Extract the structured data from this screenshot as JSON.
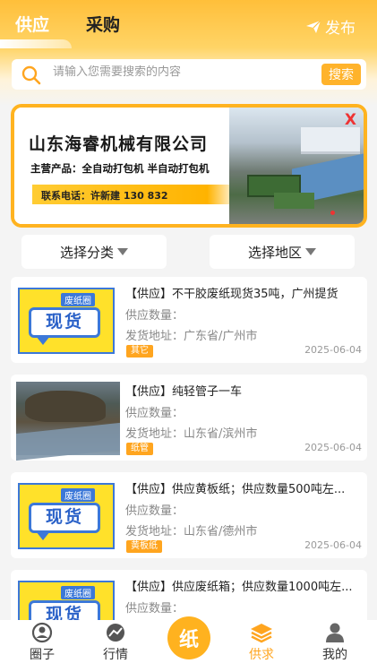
{
  "header": {
    "tab_supply": "供应",
    "tab_buy": "采购",
    "publish_label": "发布",
    "publish_icon": "paper-plane-icon"
  },
  "search": {
    "placeholder": "请输入您需要搜索的内容",
    "button_label": "搜索"
  },
  "banner": {
    "company": "山东海睿机械有限公司",
    "products": "主营产品：全自动打包机 半自动打包机",
    "contact": "联系电话：许新建 130        832",
    "close_label": "X"
  },
  "filters": {
    "category_label": "选择分类",
    "region_label": "选择地区"
  },
  "listings": [
    {
      "title": "【供应】不干胶废纸现货35吨，广州提货",
      "qty_label": "供应数量：",
      "address": "发货地址：广东省/广州市",
      "tag": "其它",
      "date": "2025-06-04",
      "thumb": "placeholder",
      "thumb_label": "废纸圈",
      "thumb_text": "现货"
    },
    {
      "title": "【供应】纯轻管子一车",
      "qty_label": "供应数量：",
      "address": "发货地址：山东省/滨州市",
      "tag": "纸管",
      "date": "2025-06-04",
      "thumb": "photo"
    },
    {
      "title": "【供应】供应黄板纸；供应数量500吨左...",
      "qty_label": "供应数量：",
      "address": "发货地址：山东省/德州市",
      "tag": "黄板纸",
      "date": "2025-06-04",
      "thumb": "placeholder",
      "thumb_label": "废纸圈",
      "thumb_text": "现货"
    },
    {
      "title": "【供应】供应废纸箱；供应数量1000吨左...",
      "qty_label": "供应数量：",
      "thumb": "placeholder",
      "thumb_label": "废纸圈",
      "thumb_text": "现货"
    }
  ],
  "tabbar": {
    "items": [
      {
        "label": "圈子",
        "icon": "user-circle-icon"
      },
      {
        "label": "行情",
        "icon": "trend-chart-icon"
      },
      {
        "label": "纸",
        "icon": "paper-circle-icon"
      },
      {
        "label": "供求",
        "icon": "layers-icon",
        "active": true
      },
      {
        "label": "我的",
        "icon": "person-icon"
      }
    ]
  },
  "colors": {
    "accent": "#ffb21f",
    "tag": "#ffa51f",
    "banner_border": "#ffb320"
  }
}
